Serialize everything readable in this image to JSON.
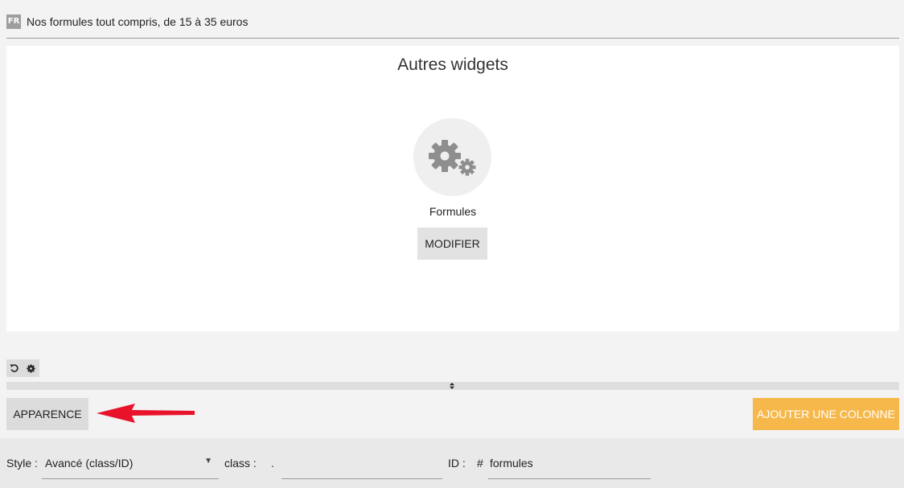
{
  "header": {
    "lang_badge": "FR",
    "title": "Nos formules tout compris, de 15 à 35 euros"
  },
  "widget": {
    "heading": "Autres widgets",
    "icon": "gears-icon",
    "name": "Formules",
    "modify_label": "MODIFIER"
  },
  "toolbar": {
    "undo_icon": "undo-icon",
    "settings_icon": "gear-icon"
  },
  "actions": {
    "appearance_label": "APPARENCE",
    "add_column_label": "AJOUTER UNE COLONNE",
    "add_column_color": "#f7b84b"
  },
  "settings": {
    "style_label": "Style :",
    "style_value": "Avancé (class/ID)",
    "class_label": "class :",
    "class_prefix": ".",
    "class_value": "",
    "id_label": "ID :",
    "id_prefix": "#",
    "id_value": "formules"
  },
  "annotation_color": "#e8132a"
}
